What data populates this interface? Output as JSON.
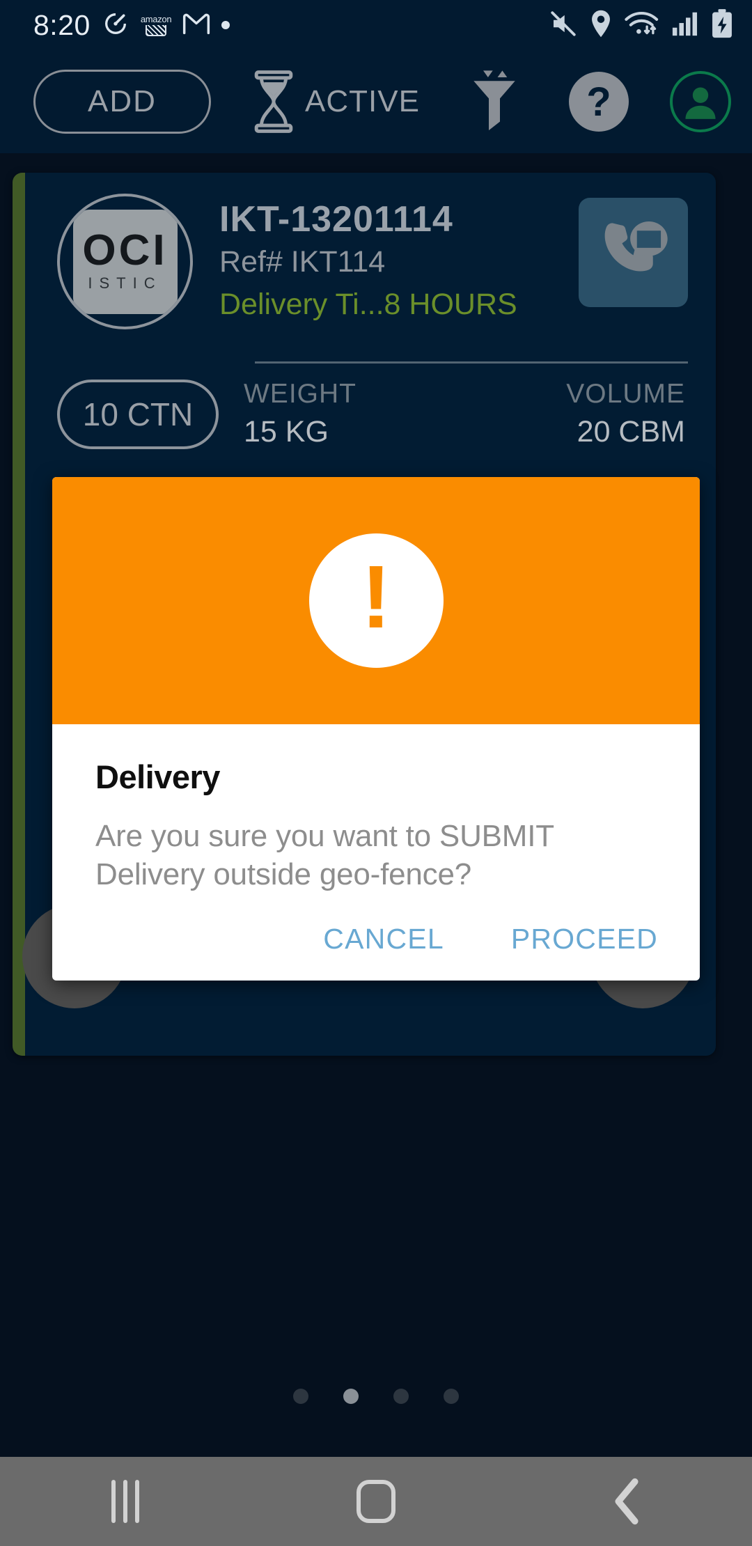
{
  "status_bar": {
    "clock": "8:20",
    "left_icons": [
      "sleep-tracker-icon",
      "amazon-icon",
      "gmail-icon",
      "generic-notification-dot"
    ],
    "amazon_wordmark": "amazon",
    "right_icons": [
      "mute-icon",
      "location-icon",
      "wifi-icon",
      "cellular-signal-icon",
      "battery-charging-icon"
    ]
  },
  "toolbar": {
    "add_label": "ADD",
    "status_filter_label": "ACTIVE",
    "hourglass_icon": "hourglass-icon",
    "filter_icon": "filter-icon",
    "help_label": "?",
    "profile_icon": "profile-avatar-icon"
  },
  "shipment_card": {
    "logo_line1": "OCI",
    "logo_line2": "ISTIC",
    "shipment_id": "IKT-13201114",
    "reference": "Ref# IKT114",
    "delivery_time": "Delivery Ti...8 HOURS",
    "contact_icon": "phone-message-icon",
    "quantity": "10 CTN",
    "metrics": [
      {
        "label": "WEIGHT",
        "value": "15 KG"
      },
      {
        "label": "VOLUME",
        "value": "20 CBM"
      }
    ],
    "accent_color": "#415a26",
    "background_color": "#021c33",
    "delivery_time_color": "#6b8f2a"
  },
  "dialog": {
    "icon": "exclamation-mark-icon",
    "icon_mark": "!",
    "header_color": "#fa8c00",
    "title": "Delivery",
    "message": "Are you sure you want to SUBMIT Delivery outside geo-fence?",
    "cancel_label": "CANCEL",
    "proceed_label": "PROCEED",
    "action_color": "#68a8d2"
  },
  "page_indicator": {
    "total": 4,
    "active_index": 1
  },
  "nav_bar": {
    "recents_icon": "recents-icon",
    "home_icon": "home-icon",
    "back_icon": "back-icon"
  }
}
